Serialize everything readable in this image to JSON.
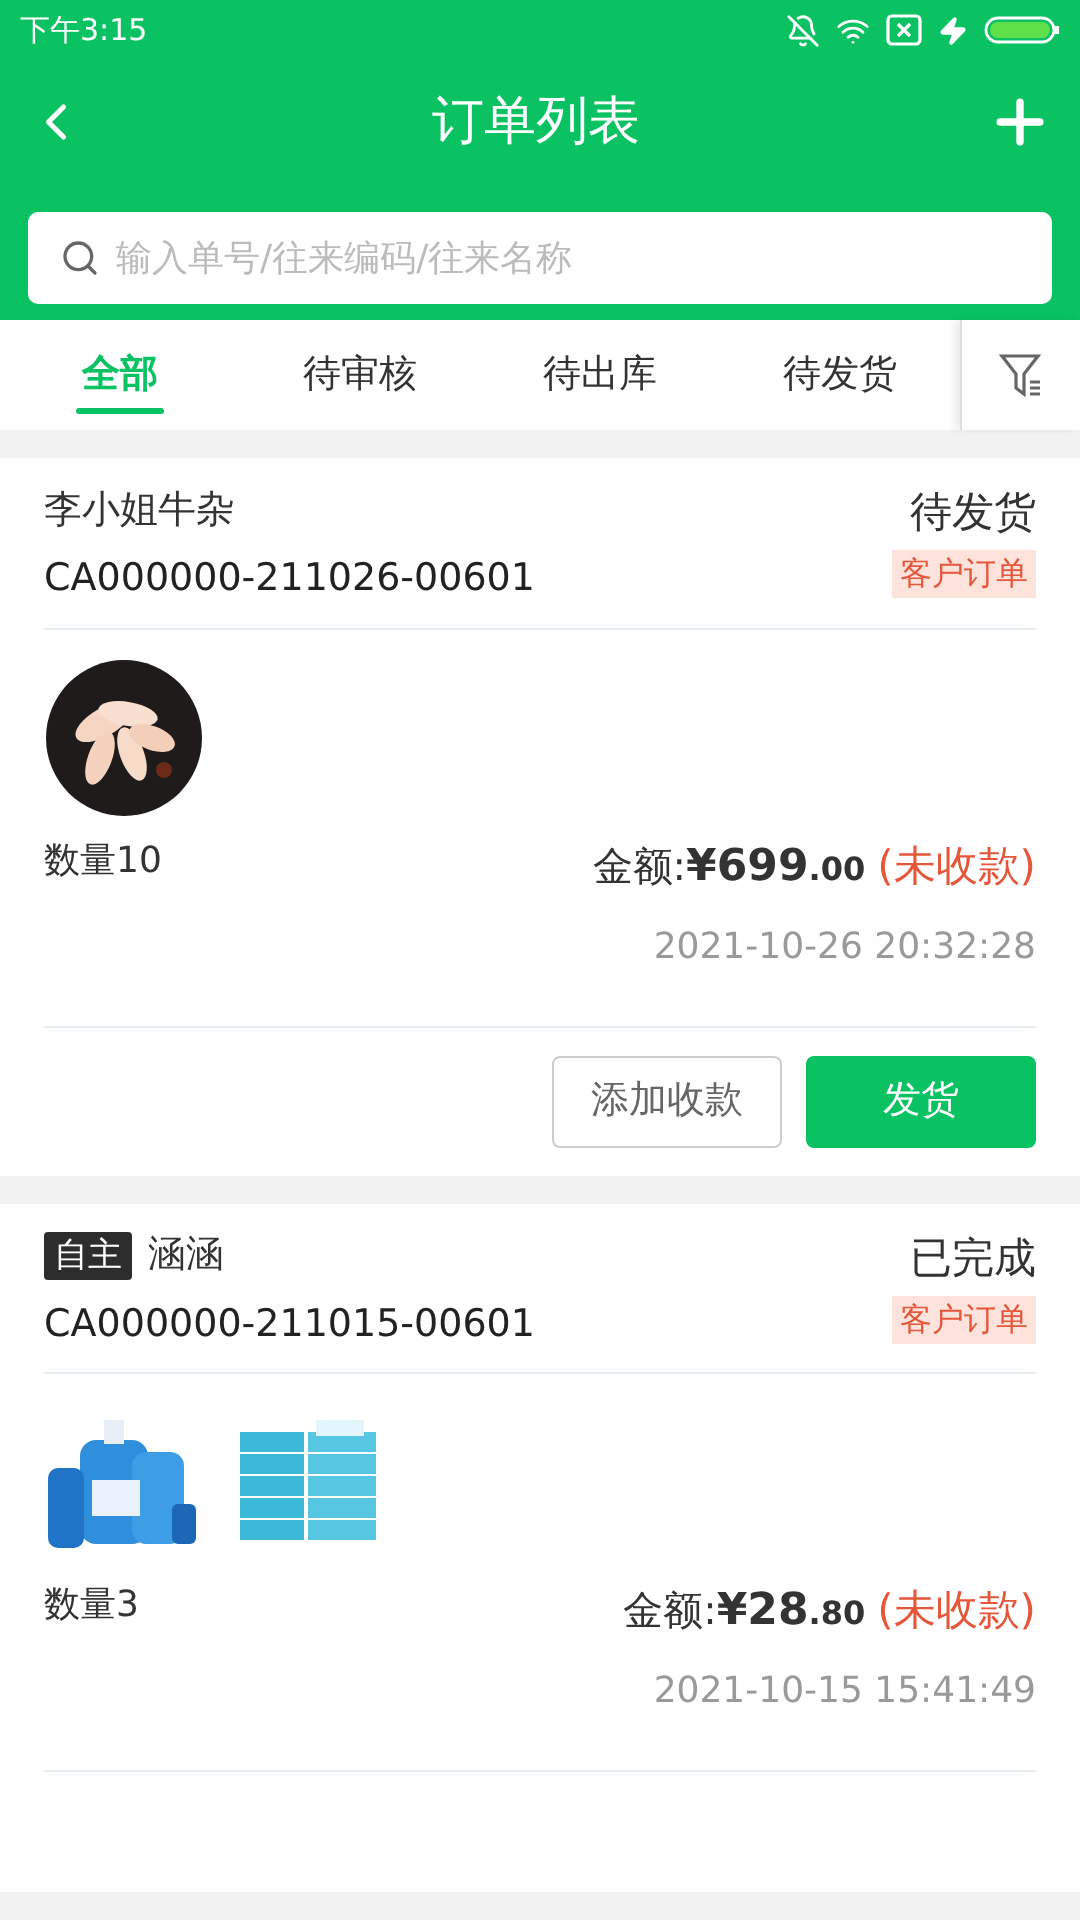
{
  "status_bar": {
    "time": "下午3:15"
  },
  "header": {
    "title": "订单列表"
  },
  "search": {
    "placeholder": "输入单号/往来编码/往来名称"
  },
  "tabs": [
    {
      "label": "全部",
      "selected": true
    },
    {
      "label": "待审核",
      "selected": false
    },
    {
      "label": "待出库",
      "selected": false
    },
    {
      "label": "待发货",
      "selected": false
    }
  ],
  "orders": [
    {
      "customer": "李小姐牛杂",
      "order_no": "CA000000-211026-00601",
      "status": "待发货",
      "type": "客户订单",
      "products": [
        {
          "kind": "food"
        }
      ],
      "quantity": "数量10",
      "amount": {
        "label": "金额:",
        "integer": "¥699",
        "decimal": ".00"
      },
      "payment_status": "(未收款)",
      "date": "2021-10-26 20:32:28",
      "buttons": [
        {
          "label": "添加收款",
          "primary": false
        },
        {
          "label": "发货",
          "primary": true
        }
      ]
    },
    {
      "tag": "自主",
      "customer": "涵涵",
      "order_no": "CA000000-211015-00601",
      "status": "已完成",
      "type": "客户订单",
      "products": [
        {
          "kind": "bottles"
        },
        {
          "kind": "tissues"
        }
      ],
      "quantity": "数量3",
      "amount": {
        "label": "金额:",
        "integer": "¥28",
        "decimal": ".80"
      },
      "payment_status": "(未收款)",
      "date": "2021-10-15 15:41:49"
    }
  ]
}
